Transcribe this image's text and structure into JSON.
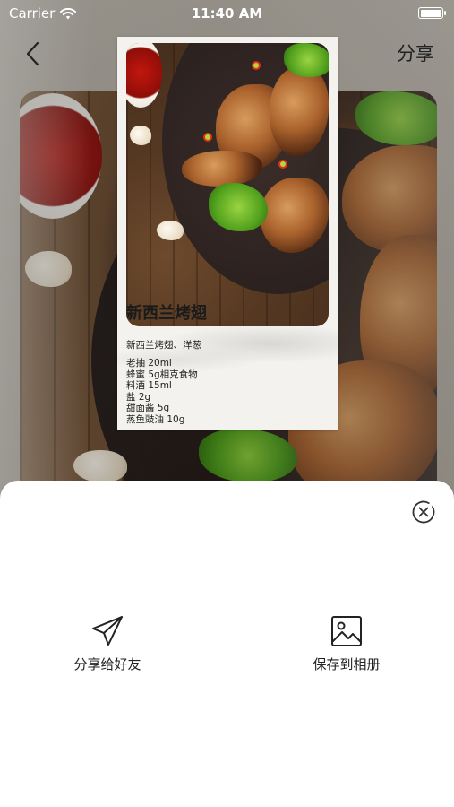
{
  "status_bar": {
    "carrier": "Carrier",
    "time": "11:40 AM"
  },
  "nav_bar": {
    "share_label": "分享"
  },
  "preview": {
    "title": "新西兰烤翅",
    "description": "新西兰烤翅、洋葱",
    "ingredients": [
      "老抽 20ml",
      "蜂蜜 5g相克食物",
      "料酒 15ml",
      "盐 2g",
      "甜面酱 5g",
      "蒸鱼豉油 10g"
    ]
  },
  "share_sheet": {
    "share_to_friends_label": "分享给好友",
    "save_to_album_label": "保存到相册"
  },
  "colors": {
    "sheet_background": "#ffffff",
    "icon_stroke": "#222222",
    "card_background": "#f4f2ee"
  }
}
